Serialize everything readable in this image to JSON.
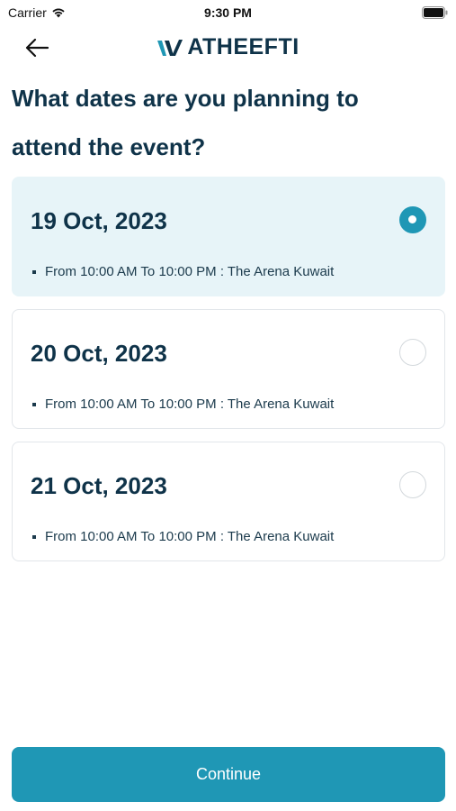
{
  "status_bar": {
    "carrier": "Carrier",
    "time": "9:30 PM"
  },
  "header": {
    "logo_text": "ATHEEFTI",
    "back_icon": "arrow-left-icon"
  },
  "page": {
    "title": "What dates are you planning to attend the event?"
  },
  "dates": [
    {
      "date": "19 Oct, 2023",
      "detail": "From  10:00 AM To  10:00 PM : The Arena Kuwait",
      "selected": true
    },
    {
      "date": "20 Oct, 2023",
      "detail": "From  10:00 AM To  10:00 PM : The Arena Kuwait",
      "selected": false
    },
    {
      "date": "21 Oct, 2023",
      "detail": "From  10:00 AM To  10:00 PM : The Arena Kuwait",
      "selected": false
    }
  ],
  "footer": {
    "continue_label": "Continue"
  },
  "colors": {
    "accent": "#1f97b5",
    "text": "#0f3349",
    "selected_bg": "#e7f4f8"
  }
}
